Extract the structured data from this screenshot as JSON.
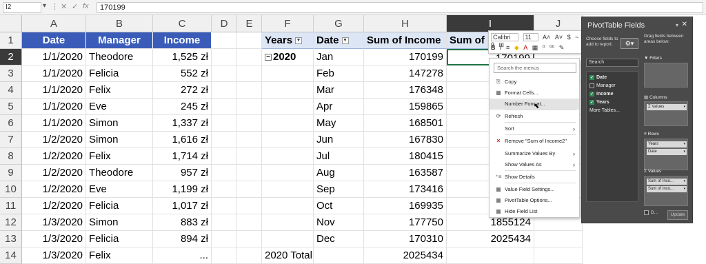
{
  "formula_bar": {
    "name_box": "I2",
    "formula": "170199",
    "buttons": [
      "▾",
      "⋮",
      "✕",
      "✓",
      "fx"
    ]
  },
  "columns": [
    "A",
    "B",
    "C",
    "D",
    "E",
    "F",
    "G",
    "H",
    "I",
    "J"
  ],
  "rows": [
    "1",
    "2",
    "3",
    "4",
    "5",
    "6",
    "7",
    "8",
    "9",
    "10",
    "11",
    "12",
    "13",
    "14"
  ],
  "source_headers": [
    "Date",
    "Manager",
    "Income"
  ],
  "source_rows": [
    [
      "1/1/2020",
      "Theodore",
      "1,525 zł"
    ],
    [
      "1/1/2020",
      "Felicia",
      "552 zł"
    ],
    [
      "1/1/2020",
      "Felix",
      "272 zł"
    ],
    [
      "1/1/2020",
      "Eve",
      "245 zł"
    ],
    [
      "1/1/2020",
      "Simon",
      "1,337 zł"
    ],
    [
      "1/2/2020",
      "Simon",
      "1,616 zł"
    ],
    [
      "1/2/2020",
      "Felix",
      "1,714 zł"
    ],
    [
      "1/2/2020",
      "Theodore",
      "957 zł"
    ],
    [
      "1/2/2020",
      "Eve",
      "1,199 zł"
    ],
    [
      "1/2/2020",
      "Felicia",
      "1,017 zł"
    ],
    [
      "1/3/2020",
      "Simon",
      "883 zł"
    ],
    [
      "1/3/2020",
      "Felicia",
      "894 zł"
    ],
    [
      "1/3/2020",
      "Felix",
      "..."
    ]
  ],
  "pivot": {
    "headers": [
      "Years",
      "Date",
      "Sum of Income",
      "Sum of I"
    ],
    "year": "2020",
    "months": [
      "Jan",
      "Feb",
      "Mar",
      "Apr",
      "May",
      "Jun",
      "Jul",
      "Aug",
      "Sep",
      "Oct",
      "Nov",
      "Dec"
    ],
    "sum_income": [
      "170199",
      "147278",
      "176348",
      "159865",
      "168501",
      "167830",
      "180415",
      "163587",
      "173416",
      "169935",
      "177750",
      "170310"
    ],
    "sum_income2_visible": {
      "jan": "170199",
      "nov": "1855124",
      "dec": "2025434"
    },
    "total_label": "2020 Total",
    "total_value": "2025434"
  },
  "mini_toolbar": {
    "font": "Calibri",
    "size": "11",
    "row1": [
      "A˄",
      "A˅",
      "$",
      "~",
      "%",
      "9",
      "⊞"
    ],
    "row2": [
      "B",
      "I",
      "≡",
      "◆",
      "A",
      "▦",
      "⁰",
      "⁰⁰",
      "✎"
    ]
  },
  "context_menu": {
    "search_placeholder": "Search the menus",
    "items": [
      {
        "label": "Copy",
        "icon": "⎘"
      },
      {
        "label": "Format Cells...",
        "icon": "▦"
      },
      {
        "label": "Number Format...",
        "icon": ""
      },
      {
        "label": "Refresh",
        "icon": "⟳"
      },
      {
        "label": "Sort",
        "icon": "",
        "sub": "›"
      },
      {
        "label": "Remove \"Sum of Income2\"",
        "icon": "✕"
      },
      {
        "label": "Summarize Values By",
        "icon": "",
        "sub": "›"
      },
      {
        "label": "Show Values As",
        "icon": "",
        "sub": "›"
      },
      {
        "label": "Show Details",
        "icon": "⁺≡"
      },
      {
        "label": "Value Field Settings...",
        "icon": "▦"
      },
      {
        "label": "PivotTable Options...",
        "icon": "▦"
      },
      {
        "label": "Hide Field List",
        "icon": "▦"
      }
    ]
  },
  "pivot_pane": {
    "title": "PivotTable Fields",
    "choose_hint": "Choose fields to add to report:",
    "search_placeholder": "Search",
    "fields": [
      {
        "name": "Date",
        "checked": true
      },
      {
        "name": "Manager",
        "checked": false
      },
      {
        "name": "Income",
        "checked": true
      },
      {
        "name": "Years",
        "checked": true
      }
    ],
    "more_tables": "More Tables...",
    "drag_hint": "Drag fields between areas below:",
    "filters_label": "Filters",
    "columns_label": "Columns",
    "columns_items": [
      "Values"
    ],
    "rows_label": "Rows",
    "rows_items": [
      "Years",
      "Date"
    ],
    "values_label": "Values",
    "values_items": [
      "Sum of Inco...",
      "Sum of Inco..."
    ],
    "defer_label": "D...",
    "update_label": "Update"
  }
}
